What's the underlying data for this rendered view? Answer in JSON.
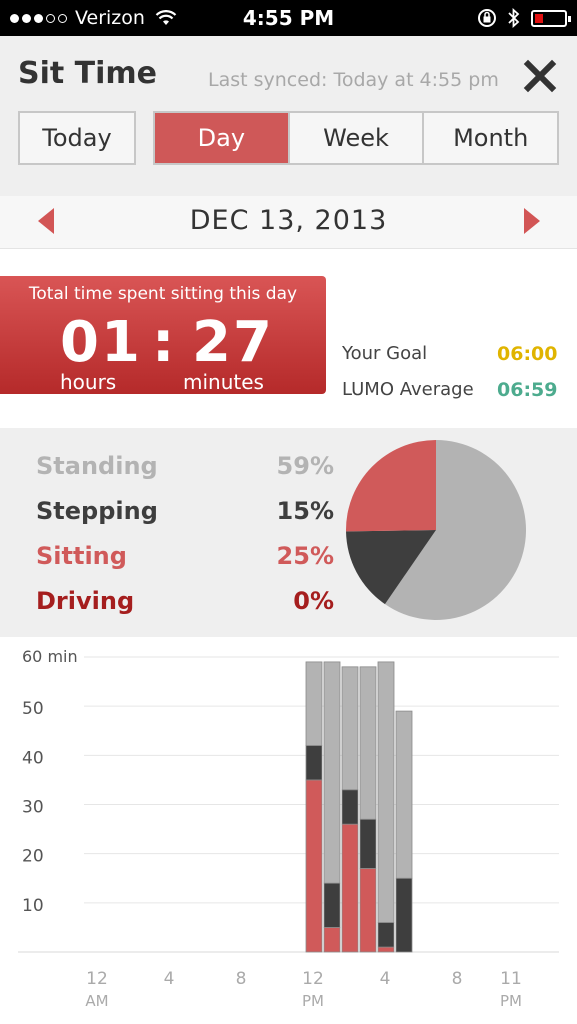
{
  "status": {
    "carrier": "Verizon",
    "time": "4:55 PM",
    "icons": [
      "signal-dots-icon",
      "wifi-icon",
      "rotation-lock-icon",
      "bluetooth-icon",
      "battery-icon"
    ]
  },
  "header": {
    "title": "Sit Time",
    "last_synced": "Last synced: Today at 4:55 pm",
    "today_label": "Today",
    "tabs": [
      {
        "label": "Day",
        "active": true
      },
      {
        "label": "Week",
        "active": false
      },
      {
        "label": "Month",
        "active": false
      }
    ]
  },
  "date_nav": {
    "date": "DEC 13, 2013"
  },
  "summary": {
    "caption": "Total time spent sitting this day",
    "hours": "01",
    "separator": ":",
    "minutes": "27",
    "hours_unit": "hours",
    "minutes_unit": "minutes",
    "goal_label": "Your Goal",
    "goal_value": "06:00",
    "average_label": "LUMO Average",
    "average_value": "06:59"
  },
  "colors": {
    "accent": "#cf5858",
    "standing": "#b3b3b3",
    "stepping": "#3e3e3e",
    "sitting": "#d05a5a",
    "driving": "#a51e1e",
    "goal": "#e0b400",
    "average": "#4dab8e"
  },
  "breakdown": [
    {
      "label": "Standing",
      "percent": "59%",
      "value": 59
    },
    {
      "label": "Stepping",
      "percent": "15%",
      "value": 15
    },
    {
      "label": "Sitting",
      "percent": "25%",
      "value": 25
    },
    {
      "label": "Driving",
      "percent": "0%",
      "value": 0
    }
  ],
  "chart_data": {
    "type": "bar",
    "stacked": true,
    "y_ticks": [
      "60 min",
      "50",
      "40",
      "30",
      "20",
      "10"
    ],
    "ylim": [
      0,
      60
    ],
    "x_ticks": [
      {
        "hour": 0,
        "line1": "12",
        "line2": "AM"
      },
      {
        "hour": 4,
        "line1": "4",
        "line2": ""
      },
      {
        "hour": 8,
        "line1": "8",
        "line2": ""
      },
      {
        "hour": 12,
        "line1": "12",
        "line2": "PM"
      },
      {
        "hour": 16,
        "line1": "4",
        "line2": ""
      },
      {
        "hour": 20,
        "line1": "8",
        "line2": ""
      },
      {
        "hour": 23,
        "line1": "11",
        "line2": "PM"
      }
    ],
    "series": [
      {
        "name": "Sitting",
        "values": [
          35,
          5,
          26,
          17,
          1,
          0
        ]
      },
      {
        "name": "Stepping",
        "values": [
          7,
          9,
          7,
          10,
          5,
          15
        ]
      },
      {
        "name": "Standing",
        "values": [
          17,
          45,
          25,
          31,
          53,
          34
        ]
      }
    ],
    "hours": [
      12,
      13,
      14,
      15,
      16,
      17
    ]
  }
}
